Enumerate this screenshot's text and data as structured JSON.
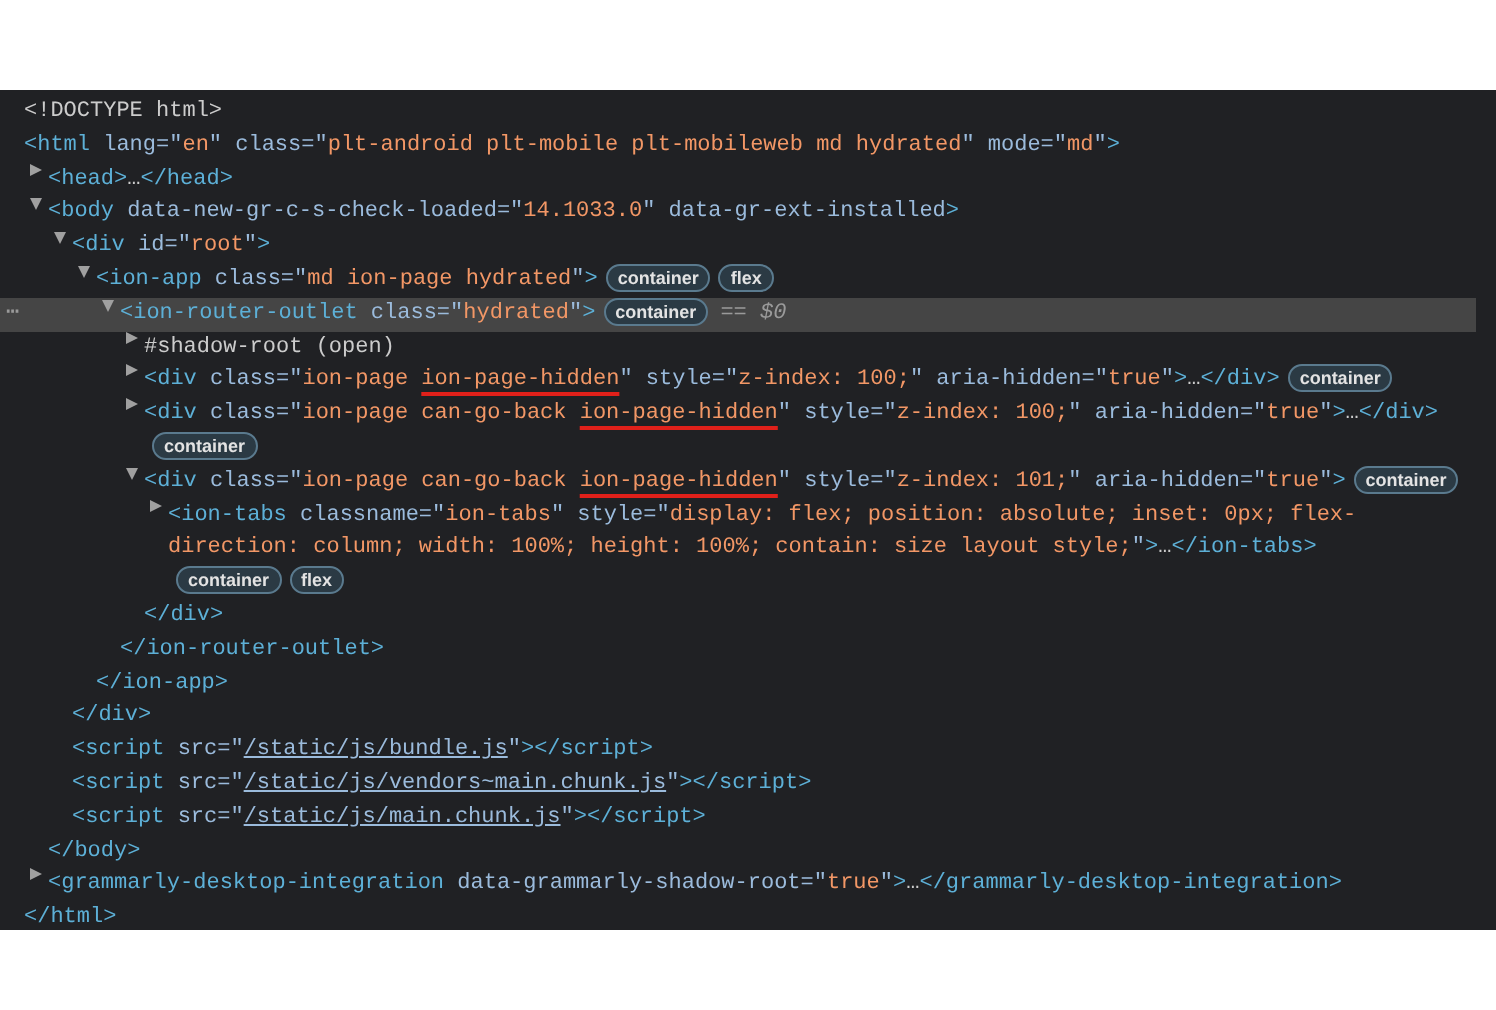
{
  "elements_tree": [
    {
      "selected": false,
      "open": [
        {
          "kind": "doctype",
          "text": "<!DOCTYPE html>"
        }
      ]
    },
    {
      "selected": false,
      "open": [
        {
          "kind": "tag",
          "text": "<html "
        },
        {
          "kind": "attr",
          "text": "lang=\""
        },
        {
          "kind": "value",
          "text": "en"
        },
        {
          "kind": "attr",
          "text": "\" class=\""
        },
        {
          "kind": "value",
          "text": "plt-android plt-mobile plt-mobileweb md hydrated"
        },
        {
          "kind": "attr",
          "text": "\" mode=\""
        },
        {
          "kind": "value",
          "text": "md"
        },
        {
          "kind": "attr",
          "text": "\""
        },
        {
          "kind": "tag",
          "text": ">"
        }
      ],
      "close": [
        {
          "kind": "tag",
          "text": "</html>"
        }
      ],
      "children": [
        {
          "selected": false,
          "expanded": false,
          "open": [
            {
              "kind": "tag",
              "text": "<head>"
            },
            {
              "kind": "plain",
              "text": "…"
            },
            {
              "kind": "tag",
              "text": "</head>"
            }
          ]
        },
        {
          "selected": false,
          "expanded": true,
          "open": [
            {
              "kind": "tag",
              "text": "<body "
            },
            {
              "kind": "attr",
              "text": "data-new-gr-c-s-check-loaded=\""
            },
            {
              "kind": "value",
              "text": "14.1033.0"
            },
            {
              "kind": "attr",
              "text": "\" data-gr-ext-installed"
            },
            {
              "kind": "tag",
              "text": ">"
            }
          ],
          "close": [
            {
              "kind": "tag",
              "text": "</body>"
            }
          ],
          "children": [
            {
              "selected": false,
              "expanded": true,
              "open": [
                {
                  "kind": "tag",
                  "text": "<div "
                },
                {
                  "kind": "attr",
                  "text": "id=\""
                },
                {
                  "kind": "value",
                  "text": "root"
                },
                {
                  "kind": "attr",
                  "text": "\""
                },
                {
                  "kind": "tag",
                  "text": ">"
                }
              ],
              "close": [
                {
                  "kind": "tag",
                  "text": "</div>"
                }
              ],
              "children": [
                {
                  "selected": false,
                  "expanded": true,
                  "open": [
                    {
                      "kind": "tag",
                      "text": "<ion-app "
                    },
                    {
                      "kind": "attr",
                      "text": "class=\""
                    },
                    {
                      "kind": "value",
                      "text": "md ion-page hydrated"
                    },
                    {
                      "kind": "attr",
                      "text": "\""
                    },
                    {
                      "kind": "tag",
                      "text": ">"
                    }
                  ],
                  "badges": [
                    "container",
                    "flex"
                  ],
                  "close": [
                    {
                      "kind": "tag",
                      "text": "</ion-app>"
                    }
                  ],
                  "children": [
                    {
                      "selected": true,
                      "expanded": true,
                      "gutter": "⋯",
                      "console_ref": "== $0",
                      "open": [
                        {
                          "kind": "tag",
                          "text": "<ion-router-outlet "
                        },
                        {
                          "kind": "attr",
                          "text": "class=\""
                        },
                        {
                          "kind": "value",
                          "text": "hydrated"
                        },
                        {
                          "kind": "attr",
                          "text": "\""
                        },
                        {
                          "kind": "tag",
                          "text": ">"
                        }
                      ],
                      "badges": [
                        "container"
                      ],
                      "close": [
                        {
                          "kind": "tag",
                          "text": "</ion-router-outlet>"
                        }
                      ],
                      "children": [
                        {
                          "selected": false,
                          "expanded": false,
                          "open": [
                            {
                              "kind": "plain",
                              "text": "#shadow-root (open)"
                            }
                          ]
                        },
                        {
                          "selected": false,
                          "expanded": false,
                          "open": [
                            {
                              "kind": "tag",
                              "text": "<div "
                            },
                            {
                              "kind": "attr",
                              "text": "class=\""
                            },
                            {
                              "kind": "value",
                              "text": "ion-page "
                            },
                            {
                              "kind": "value",
                              "text": "ion-page-hidden",
                              "marked": true
                            },
                            {
                              "kind": "attr",
                              "text": "\" style=\""
                            },
                            {
                              "kind": "value",
                              "text": "z-index: 100;"
                            },
                            {
                              "kind": "attr",
                              "text": "\" aria-hidden=\""
                            },
                            {
                              "kind": "value",
                              "text": "true"
                            },
                            {
                              "kind": "attr",
                              "text": "\""
                            },
                            {
                              "kind": "tag",
                              "text": ">"
                            },
                            {
                              "kind": "plain",
                              "text": "…"
                            },
                            {
                              "kind": "tag",
                              "text": "</div>"
                            }
                          ],
                          "badges": [
                            "container"
                          ]
                        },
                        {
                          "selected": false,
                          "expanded": false,
                          "open": [
                            {
                              "kind": "tag",
                              "text": "<div "
                            },
                            {
                              "kind": "attr",
                              "text": "class=\""
                            },
                            {
                              "kind": "value",
                              "text": "ion-page can-go-back "
                            },
                            {
                              "kind": "value",
                              "text": "ion-page-hidden",
                              "marked": true
                            },
                            {
                              "kind": "attr",
                              "text": "\" style=\""
                            },
                            {
                              "kind": "value",
                              "text": "z-index: 100;"
                            },
                            {
                              "kind": "attr",
                              "text": "\" aria-hidden=\""
                            },
                            {
                              "kind": "value",
                              "text": "true"
                            },
                            {
                              "kind": "attr",
                              "text": "\""
                            },
                            {
                              "kind": "tag",
                              "text": ">"
                            },
                            {
                              "kind": "plain",
                              "text": "…"
                            },
                            {
                              "kind": "tag",
                              "text": "</div>"
                            }
                          ],
                          "badges": [
                            "container"
                          ]
                        },
                        {
                          "selected": false,
                          "expanded": true,
                          "open": [
                            {
                              "kind": "tag",
                              "text": "<div "
                            },
                            {
                              "kind": "attr",
                              "text": "class=\""
                            },
                            {
                              "kind": "value",
                              "text": "ion-page can-go-back "
                            },
                            {
                              "kind": "value",
                              "text": "ion-page-hidden",
                              "marked": true
                            },
                            {
                              "kind": "attr",
                              "text": "\" style=\""
                            },
                            {
                              "kind": "value",
                              "text": "z-index: 101;"
                            },
                            {
                              "kind": "attr",
                              "text": "\" aria-hidden=\""
                            },
                            {
                              "kind": "value",
                              "text": "true"
                            },
                            {
                              "kind": "attr",
                              "text": "\""
                            },
                            {
                              "kind": "tag",
                              "text": ">"
                            }
                          ],
                          "badges": [
                            "container"
                          ],
                          "close": [
                            {
                              "kind": "tag",
                              "text": "</div>"
                            }
                          ],
                          "children": [
                            {
                              "selected": false,
                              "expanded": false,
                              "open": [
                                {
                                  "kind": "tag",
                                  "text": "<ion-tabs "
                                },
                                {
                                  "kind": "attr",
                                  "text": "classname=\""
                                },
                                {
                                  "kind": "value",
                                  "text": "ion-tabs"
                                },
                                {
                                  "kind": "attr",
                                  "text": "\" style=\""
                                },
                                {
                                  "kind": "value",
                                  "text": "display: flex; position: absolute; inset: 0px; flex-direction: column; width: 100%; height: 100%; contain: size layout style;"
                                },
                                {
                                  "kind": "attr",
                                  "text": "\""
                                },
                                {
                                  "kind": "tag",
                                  "text": ">"
                                },
                                {
                                  "kind": "plain",
                                  "text": "…"
                                },
                                {
                                  "kind": "tag",
                                  "text": "</ion-tabs>"
                                }
                              ],
                              "badges": [
                                "container",
                                "flex"
                              ]
                            }
                          ]
                        }
                      ]
                    }
                  ]
                }
              ]
            },
            {
              "selected": false,
              "open": [
                {
                  "kind": "tag",
                  "text": "<script "
                },
                {
                  "kind": "attr",
                  "text": "src=\""
                },
                {
                  "kind": "link",
                  "text": "/static/js/bundle.js"
                },
                {
                  "kind": "attr",
                  "text": "\""
                },
                {
                  "kind": "tag",
                  "text": "></script>"
                }
              ]
            },
            {
              "selected": false,
              "open": [
                {
                  "kind": "tag",
                  "text": "<script "
                },
                {
                  "kind": "attr",
                  "text": "src=\""
                },
                {
                  "kind": "link",
                  "text": "/static/js/vendors~main.chunk.js"
                },
                {
                  "kind": "attr",
                  "text": "\""
                },
                {
                  "kind": "tag",
                  "text": "></script>"
                }
              ]
            },
            {
              "selected": false,
              "open": [
                {
                  "kind": "tag",
                  "text": "<script "
                },
                {
                  "kind": "attr",
                  "text": "src=\""
                },
                {
                  "kind": "link",
                  "text": "/static/js/main.chunk.js"
                },
                {
                  "kind": "attr",
                  "text": "\""
                },
                {
                  "kind": "tag",
                  "text": "></script>"
                }
              ]
            }
          ]
        },
        {
          "selected": false,
          "expanded": false,
          "open": [
            {
              "kind": "tag",
              "text": "<grammarly-desktop-integration "
            },
            {
              "kind": "attr",
              "text": "data-grammarly-shadow-root=\""
            },
            {
              "kind": "value",
              "text": "true"
            },
            {
              "kind": "attr",
              "text": "\""
            },
            {
              "kind": "tag",
              "text": ">"
            },
            {
              "kind": "plain",
              "text": "…"
            },
            {
              "kind": "tag",
              "text": "</grammarly-desktop-integration>"
            }
          ]
        }
      ]
    }
  ]
}
